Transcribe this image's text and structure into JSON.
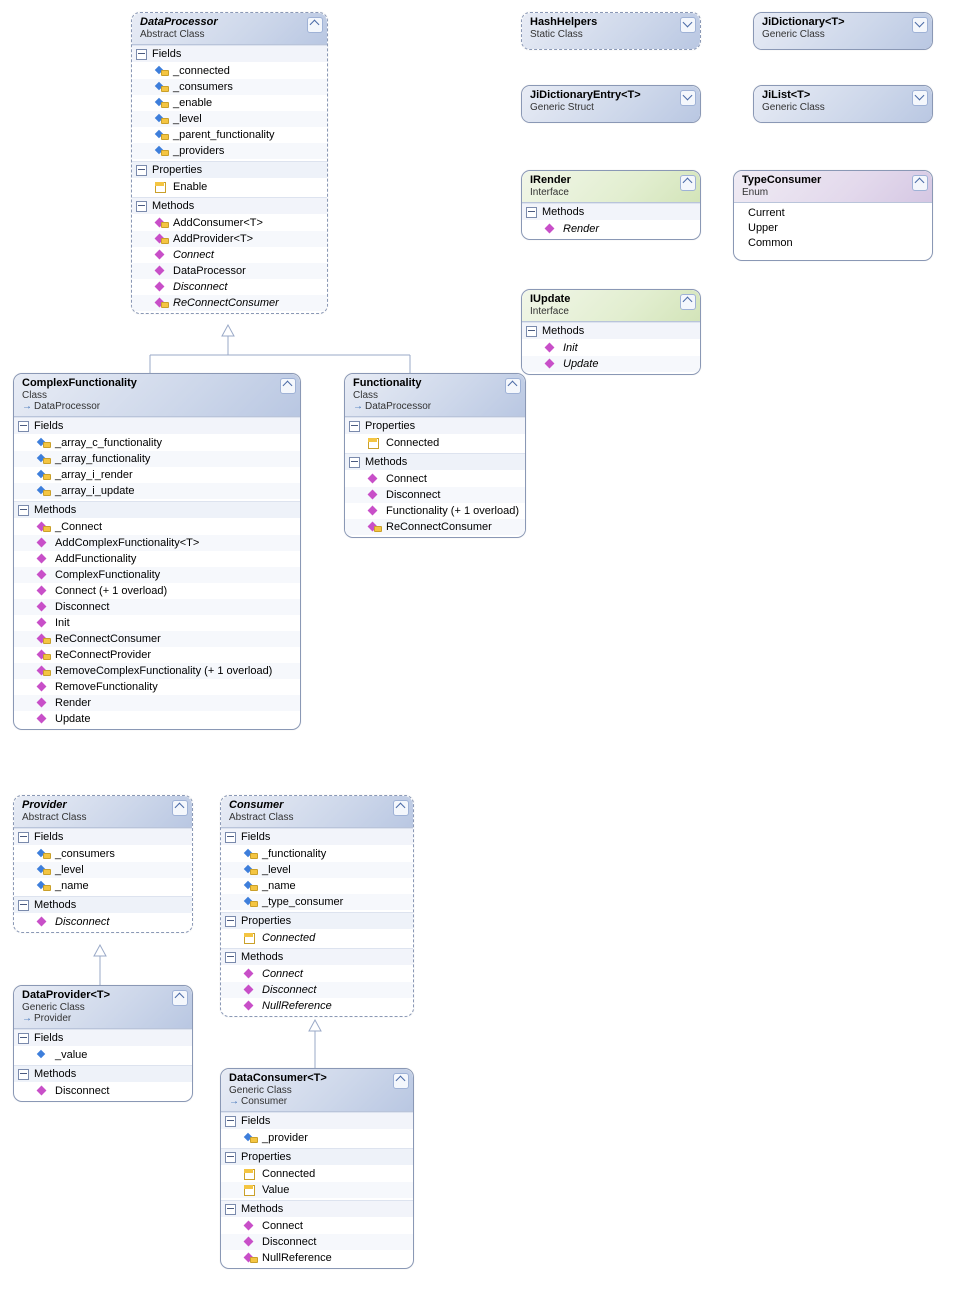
{
  "classes": {
    "dataProcessor": {
      "title": "DataProcessor",
      "subtitle": "Abstract Class",
      "sections": {
        "fields": {
          "label": "Fields",
          "items": [
            {
              "name": "_connected",
              "icon": "field"
            },
            {
              "name": "_consumers",
              "icon": "field"
            },
            {
              "name": "_enable",
              "icon": "field"
            },
            {
              "name": "_level",
              "icon": "field"
            },
            {
              "name": "_parent_functionality",
              "icon": "field"
            },
            {
              "name": "_providers",
              "icon": "field"
            }
          ]
        },
        "properties": {
          "label": "Properties",
          "items": [
            {
              "name": "Enable",
              "icon": "prop"
            }
          ]
        },
        "methods": {
          "label": "Methods",
          "items": [
            {
              "name": "AddConsumer<T>",
              "icon": "method",
              "prot": true
            },
            {
              "name": "AddProvider<T>",
              "icon": "method",
              "prot": true
            },
            {
              "name": "Connect",
              "icon": "method",
              "italic": true
            },
            {
              "name": "DataProcessor",
              "icon": "method"
            },
            {
              "name": "Disconnect",
              "icon": "method",
              "italic": true
            },
            {
              "name": "ReConnectConsumer",
              "icon": "method",
              "italic": true,
              "prot": true
            }
          ]
        }
      }
    },
    "complexFunctionality": {
      "title": "ComplexFunctionality",
      "subtitle": "Class",
      "base": "DataProcessor",
      "sections": {
        "fields": {
          "label": "Fields",
          "items": [
            {
              "name": "_array_c_functionality",
              "icon": "field"
            },
            {
              "name": "_array_functionality",
              "icon": "field"
            },
            {
              "name": "_array_i_render",
              "icon": "field"
            },
            {
              "name": "_array_i_update",
              "icon": "field"
            }
          ]
        },
        "methods": {
          "label": "Methods",
          "items": [
            {
              "name": "_Connect",
              "icon": "method",
              "prot": true
            },
            {
              "name": "AddComplexFunctionality<T>",
              "icon": "method"
            },
            {
              "name": "AddFunctionality",
              "icon": "method"
            },
            {
              "name": "ComplexFunctionality",
              "icon": "method"
            },
            {
              "name": "Connect (+ 1 overload)",
              "icon": "method"
            },
            {
              "name": "Disconnect",
              "icon": "method"
            },
            {
              "name": "Init",
              "icon": "method"
            },
            {
              "name": "ReConnectConsumer",
              "icon": "method",
              "prot": true
            },
            {
              "name": "ReConnectProvider",
              "icon": "method",
              "prot": true
            },
            {
              "name": "RemoveComplexFunctionality (+ 1 overload)",
              "icon": "method",
              "prot": true
            },
            {
              "name": "RemoveFunctionality",
              "icon": "method"
            },
            {
              "name": "Render",
              "icon": "method"
            },
            {
              "name": "Update",
              "icon": "method"
            }
          ]
        }
      }
    },
    "functionality": {
      "title": "Functionality",
      "subtitle": "Class",
      "base": "DataProcessor",
      "sections": {
        "properties": {
          "label": "Properties",
          "items": [
            {
              "name": "Connected",
              "icon": "prop"
            }
          ]
        },
        "methods": {
          "label": "Methods",
          "items": [
            {
              "name": "Connect",
              "icon": "method"
            },
            {
              "name": "Disconnect",
              "icon": "method"
            },
            {
              "name": "Functionality (+ 1 overload)",
              "icon": "method"
            },
            {
              "name": "ReConnectConsumer",
              "icon": "method",
              "prot": true
            }
          ]
        }
      }
    },
    "provider": {
      "title": "Provider",
      "subtitle": "Abstract Class",
      "sections": {
        "fields": {
          "label": "Fields",
          "items": [
            {
              "name": "_consumers",
              "icon": "field"
            },
            {
              "name": "_level",
              "icon": "field"
            },
            {
              "name": "_name",
              "icon": "field"
            }
          ]
        },
        "methods": {
          "label": "Methods",
          "items": [
            {
              "name": "Disconnect",
              "icon": "method",
              "italic": true
            }
          ]
        }
      }
    },
    "dataProvider": {
      "title": "DataProvider<T>",
      "subtitle": "Generic Class",
      "base": "Provider",
      "sections": {
        "fields": {
          "label": "Fields",
          "items": [
            {
              "name": "_value",
              "icon": "field",
              "nokey": true
            }
          ]
        },
        "methods": {
          "label": "Methods",
          "items": [
            {
              "name": "Disconnect",
              "icon": "method"
            }
          ]
        }
      }
    },
    "consumer": {
      "title": "Consumer",
      "subtitle": "Abstract Class",
      "sections": {
        "fields": {
          "label": "Fields",
          "items": [
            {
              "name": "_functionality",
              "icon": "field"
            },
            {
              "name": "_level",
              "icon": "field"
            },
            {
              "name": "_name",
              "icon": "field"
            },
            {
              "name": "_type_consumer",
              "icon": "field"
            }
          ]
        },
        "properties": {
          "label": "Properties",
          "items": [
            {
              "name": "Connected",
              "icon": "prop",
              "italic": true
            }
          ]
        },
        "methods": {
          "label": "Methods",
          "items": [
            {
              "name": "Connect",
              "icon": "method",
              "italic": true
            },
            {
              "name": "Disconnect",
              "icon": "method",
              "italic": true
            },
            {
              "name": "NullReference",
              "icon": "method",
              "italic": true
            }
          ]
        }
      }
    },
    "dataConsumer": {
      "title": "DataConsumer<T>",
      "subtitle": "Generic Class",
      "base": "Consumer",
      "sections": {
        "fields": {
          "label": "Fields",
          "items": [
            {
              "name": "_provider",
              "icon": "field"
            }
          ]
        },
        "properties": {
          "label": "Properties",
          "items": [
            {
              "name": "Connected",
              "icon": "prop"
            },
            {
              "name": "Value",
              "icon": "prop"
            }
          ]
        },
        "methods": {
          "label": "Methods",
          "items": [
            {
              "name": "Connect",
              "icon": "method"
            },
            {
              "name": "Disconnect",
              "icon": "method"
            },
            {
              "name": "NullReference",
              "icon": "method",
              "prot": true
            }
          ]
        }
      }
    },
    "hashHelpers": {
      "title": "HashHelpers",
      "subtitle": "Static Class"
    },
    "jiDictionary": {
      "title": "JiDictionary<T>",
      "subtitle": "Generic Class"
    },
    "jiDictionaryEntry": {
      "title": "JiDictionaryEntry<T>",
      "subtitle": "Generic Struct"
    },
    "jiList": {
      "title": "JiList<T>",
      "subtitle": "Generic Class"
    },
    "iRender": {
      "title": "IRender",
      "subtitle": "Interface",
      "sections": {
        "methods": {
          "label": "Methods",
          "items": [
            {
              "name": "Render",
              "icon": "method",
              "italic": true
            }
          ]
        }
      }
    },
    "iUpdate": {
      "title": "IUpdate",
      "subtitle": "Interface",
      "sections": {
        "methods": {
          "label": "Methods",
          "items": [
            {
              "name": "Init",
              "icon": "method",
              "italic": true
            },
            {
              "name": "Update",
              "icon": "method",
              "italic": true
            }
          ]
        }
      }
    },
    "typeConsumer": {
      "title": "TypeConsumer",
      "subtitle": "Enum",
      "values": [
        "Current",
        "Upper",
        "Common"
      ]
    }
  }
}
